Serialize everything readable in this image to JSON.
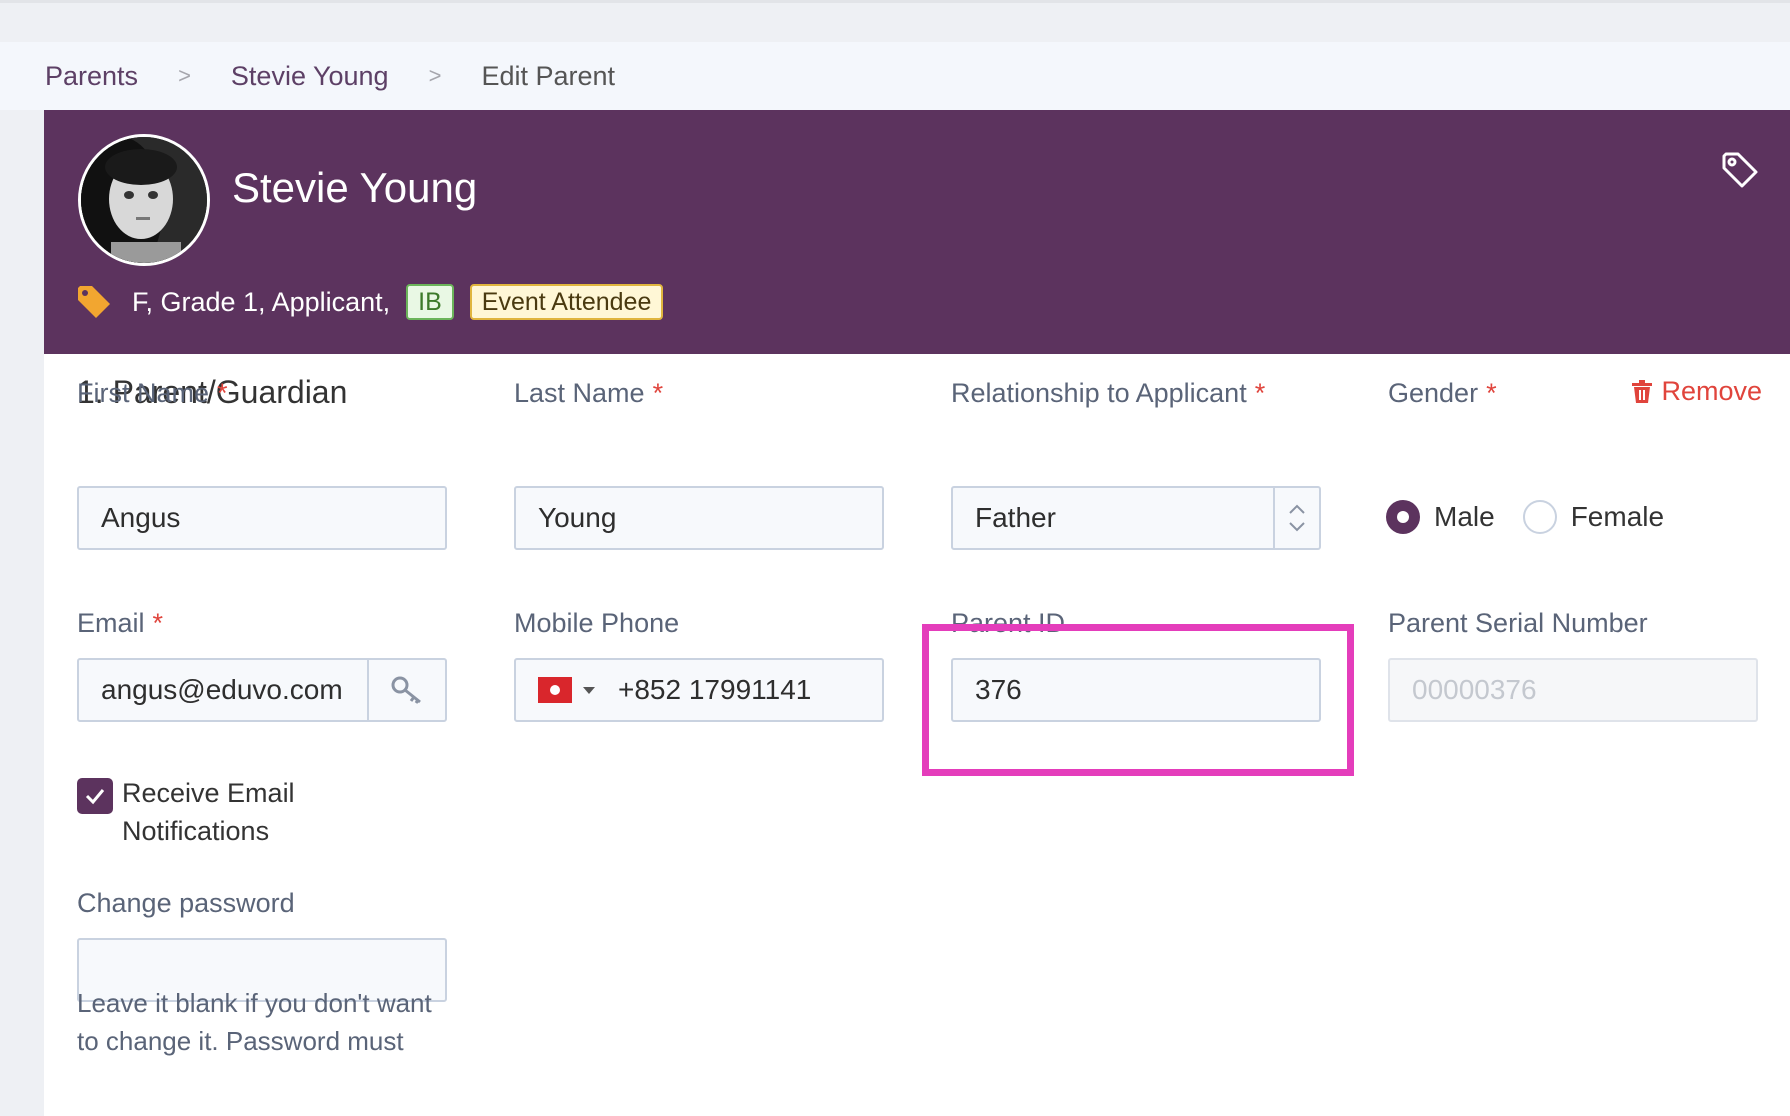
{
  "breadcrumb": {
    "items": [
      "Parents",
      "Stevie Young",
      "Edit Parent"
    ],
    "separator": ">"
  },
  "header": {
    "name": "Stevie Young",
    "meta": "F, Grade 1, Applicant,",
    "badges": [
      "IB",
      "Event Attendee"
    ],
    "background_color": "#5c335e"
  },
  "section": {
    "title": "1. Parent/Guardian",
    "remove_label": "Remove"
  },
  "form": {
    "first_name": {
      "label": "First Name",
      "required": "*",
      "value": "Angus"
    },
    "last_name": {
      "label": "Last Name",
      "required": "*",
      "value": "Young"
    },
    "relationship": {
      "label": "Relationship to Applicant",
      "required": "*",
      "value": "Father"
    },
    "gender": {
      "label": "Gender",
      "required": "*",
      "options": [
        "Male",
        "Female"
      ],
      "selected": "Male"
    },
    "email": {
      "label": "Email",
      "required": "*",
      "value": "angus@eduvo.com"
    },
    "mobile": {
      "label": "Mobile Phone",
      "value": "+852 17991141",
      "country_flag": "hong-kong-flag"
    },
    "parent_id": {
      "label": "Parent ID",
      "value": "376"
    },
    "serial": {
      "label": "Parent Serial Number",
      "placeholder": "00000376"
    },
    "notifications": {
      "label": "Receive Email Notifications",
      "checked": true
    },
    "password": {
      "label": "Change password",
      "value": "",
      "help": "Leave it blank if you don't want to change it. Password must"
    }
  },
  "colors": {
    "accent": "#5c335e",
    "required": "#e0443c",
    "highlight": "#e43dbb",
    "badge_ib": "#6bb45a",
    "badge_event": "#e0b53e"
  }
}
